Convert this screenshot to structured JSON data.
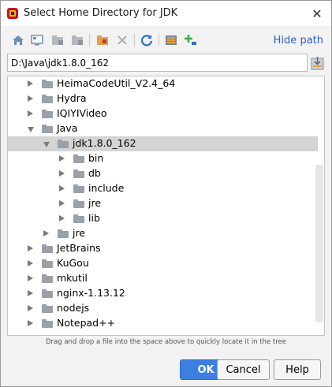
{
  "window": {
    "title": "Select Home Directory for JDK",
    "close_glyph": "✕"
  },
  "toolbar": {
    "icons": [
      "home-icon",
      "desktop-icon",
      "project-icon",
      "module-icon",
      "new-folder-icon",
      "delete-icon",
      "refresh-icon",
      "show-hidden-icon",
      "expand-icon"
    ],
    "hide_path_label": "Hide path"
  },
  "path": {
    "value": "D:\\Java\\jdk1.8.0_162"
  },
  "tree": {
    "items": [
      {
        "label": "HeimaCodeUtil_V2.4_64",
        "depth": 0,
        "expanded": false,
        "selected": false
      },
      {
        "label": "Hydra",
        "depth": 0,
        "expanded": false,
        "selected": false
      },
      {
        "label": "IQIYIVideo",
        "depth": 0,
        "expanded": false,
        "selected": false
      },
      {
        "label": "Java",
        "depth": 0,
        "expanded": true,
        "selected": false
      },
      {
        "label": "jdk1.8.0_162",
        "depth": 1,
        "expanded": true,
        "selected": true
      },
      {
        "label": "bin",
        "depth": 2,
        "expanded": false,
        "selected": false
      },
      {
        "label": "db",
        "depth": 2,
        "expanded": false,
        "selected": false
      },
      {
        "label": "include",
        "depth": 2,
        "expanded": false,
        "selected": false
      },
      {
        "label": "jre",
        "depth": 2,
        "expanded": false,
        "selected": false
      },
      {
        "label": "lib",
        "depth": 2,
        "expanded": false,
        "selected": false
      },
      {
        "label": "jre",
        "depth": 1,
        "expanded": false,
        "selected": false
      },
      {
        "label": "JetBrains",
        "depth": 0,
        "expanded": false,
        "selected": false
      },
      {
        "label": "KuGou",
        "depth": 0,
        "expanded": false,
        "selected": false
      },
      {
        "label": "mkutil",
        "depth": 0,
        "expanded": false,
        "selected": false
      },
      {
        "label": "nginx-1.13.12",
        "depth": 0,
        "expanded": false,
        "selected": false
      },
      {
        "label": "nodejs",
        "depth": 0,
        "expanded": false,
        "selected": false
      },
      {
        "label": "Notepad++",
        "depth": 0,
        "expanded": false,
        "selected": false
      }
    ]
  },
  "hint": "Drag and drop a file into the space above to quickly locate it in the tree",
  "buttons": {
    "ok": "OK",
    "cancel": "Cancel",
    "help": "Help"
  },
  "colors": {
    "accent": "#3d7fe0",
    "link": "#2b5fc2",
    "selection": "#d4d4d4",
    "folder": "#9aa1a8"
  }
}
